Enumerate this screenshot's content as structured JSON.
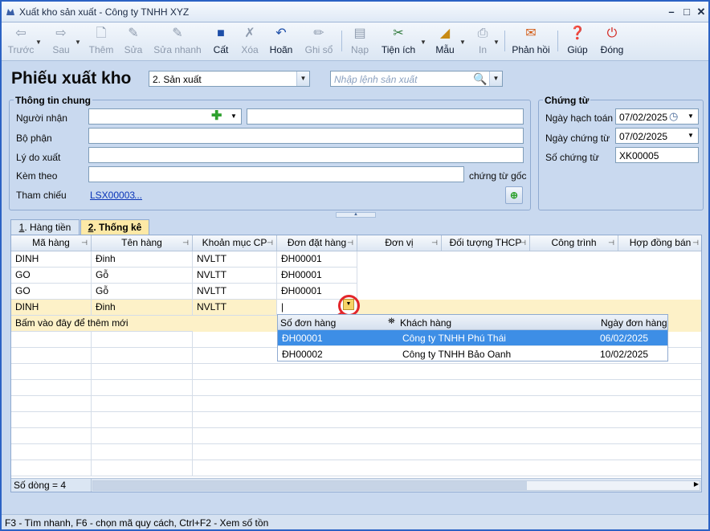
{
  "window": {
    "title": "Xuất kho sản xuất - Công ty TNHH XYZ"
  },
  "toolbar": {
    "back": "Trước",
    "next": "Sau",
    "add": "Thêm",
    "edit": "Sửa",
    "quick_edit": "Sửa nhanh",
    "save": "Cất",
    "delete": "Xóa",
    "undo": "Hoãn",
    "post": "Ghi sổ",
    "load": "Nạp",
    "utilities": "Tiện ích",
    "template": "Mẫu",
    "print": "In",
    "feedback": "Phản hồi",
    "help": "Giúp",
    "close": "Đóng"
  },
  "header": {
    "title": "Phiếu xuất kho",
    "type_select": "2. Sản xuất",
    "search_placeholder": "Nhập lệnh sản xuất"
  },
  "general_info": {
    "title": "Thông tin chung",
    "recipient_label": "Người nhận",
    "department_label": "Bộ phận",
    "reason_label": "Lý do xuất",
    "attachment_label": "Kèm theo",
    "attachment_suffix": "chứng từ gốc",
    "reference_label": "Tham chiếu",
    "reference_value": "LSX00003",
    "reference_more": "..."
  },
  "voucher": {
    "title": "Chứng từ",
    "posting_date_label": "Ngày hạch toán",
    "posting_date": "07/02/2025",
    "voucher_date_label": "Ngày chứng từ",
    "voucher_date": "07/02/2025",
    "voucher_no_label": "Số chứng từ",
    "voucher_no": "XK00005"
  },
  "tabs": [
    {
      "num": "1",
      "label": ". Hàng tiền"
    },
    {
      "num": "2",
      "label": ". Thống kê"
    }
  ],
  "grid": {
    "columns": [
      "Mã hàng",
      "Tên hàng",
      "Khoản mục CP",
      "Đơn đặt hàng",
      "Đơn vị",
      "Đối tượng THCP",
      "Công trình",
      "Hợp đồng bán"
    ],
    "rows": [
      [
        "DINH",
        "Đinh",
        "NVLTT",
        "ĐH00001"
      ],
      [
        "GO",
        "Gỗ",
        "NVLTT",
        "ĐH00001"
      ],
      [
        "GO",
        "Gỗ",
        "NVLTT",
        "ĐH00001"
      ],
      [
        "DINH",
        "Đinh",
        "NVLTT",
        "|"
      ]
    ],
    "new_row_hint": "Bấm vào đây để thêm mới",
    "row_count": "Số dòng = 4"
  },
  "dropdown": {
    "columns": [
      "Số đơn hàng",
      "Khách hàng",
      "Ngày đơn hàng"
    ],
    "rows": [
      [
        "ĐH00001",
        "Công ty TNHH Phú Thái",
        "06/02/2025"
      ],
      [
        "ĐH00002",
        "Công ty TNHH Bảo Oanh",
        "10/02/2025"
      ]
    ]
  },
  "status": "F3 - Tìm nhanh, F6 - chọn mã quy cách, Ctrl+F2 - Xem số tồn",
  "colors": {
    "accent": "#2b62c4",
    "highlight_row": "#3d8ee6",
    "annotation": "#e3262a"
  }
}
